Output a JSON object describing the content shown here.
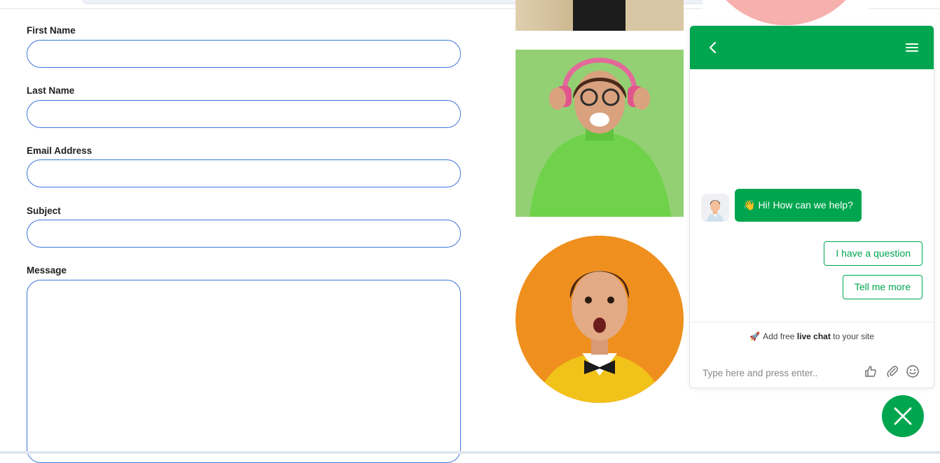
{
  "form": {
    "first_name_label": "First Name",
    "last_name_label": "Last Name",
    "email_label": "Email Address",
    "subject_label": "Subject",
    "message_label": "Message",
    "first_name_value": "",
    "last_name_value": "",
    "email_value": "",
    "subject_value": "",
    "message_value": ""
  },
  "chat": {
    "greeting": "Hi! How can we help?",
    "greeting_emoji": "👋",
    "quick_replies": [
      "I have a question",
      "Tell me more"
    ],
    "promo_prefix": "Add free",
    "promo_bold": "live chat",
    "promo_suffix": "to your site",
    "promo_emoji": "🚀",
    "input_placeholder": "Type here and press enter..",
    "accent_color": "#00a64f"
  },
  "icons": [
    "back-arrow-icon",
    "menu-icon",
    "thumbs-up-icon",
    "paperclip-icon",
    "smiley-icon",
    "close-icon"
  ]
}
